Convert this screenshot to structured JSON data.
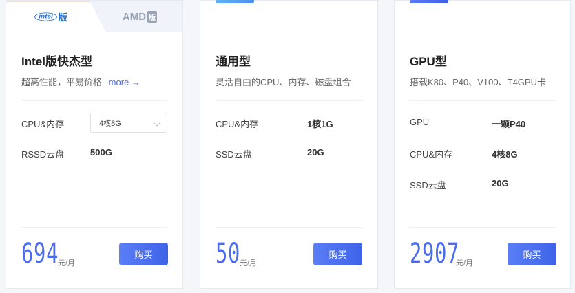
{
  "colors": {
    "accent": "#4a6cf0",
    "intel_blue": "#1f6fd1",
    "amd_gray": "#9aa3b3"
  },
  "cards": [
    {
      "brand_tabs": {
        "intel": {
          "logo": "intel",
          "suffix": "版"
        },
        "amd": {
          "logo": "AMD",
          "suffix": "版"
        }
      },
      "title": "Intel版快杰型",
      "subtitle": "超高性能，平易价格",
      "more_label": "more →",
      "specs": [
        {
          "label": "CPU&内存",
          "value": "4核8G",
          "type": "select"
        },
        {
          "label": "RSSD云盘",
          "value": "500G"
        }
      ],
      "price": "694",
      "price_unit": "元/月",
      "buy_label": "购买"
    },
    {
      "title": "通用型",
      "subtitle": "灵活自由的CPU、内存、磁盘组合",
      "specs": [
        {
          "label": "CPU&内存",
          "value": "1核1G"
        },
        {
          "label": "SSD云盘",
          "value": "20G"
        }
      ],
      "price": "50",
      "price_unit": "元/月",
      "buy_label": "购买"
    },
    {
      "title": "GPU型",
      "subtitle": "搭载K80、P40、V100、T4GPU卡",
      "specs": [
        {
          "label": "GPU",
          "value": "一颗P40"
        },
        {
          "label": "CPU&内存",
          "value": "4核8G"
        },
        {
          "label": "SSD云盘",
          "value": "20G"
        }
      ],
      "price": "2907",
      "price_unit": "元/月",
      "buy_label": "购买"
    }
  ]
}
